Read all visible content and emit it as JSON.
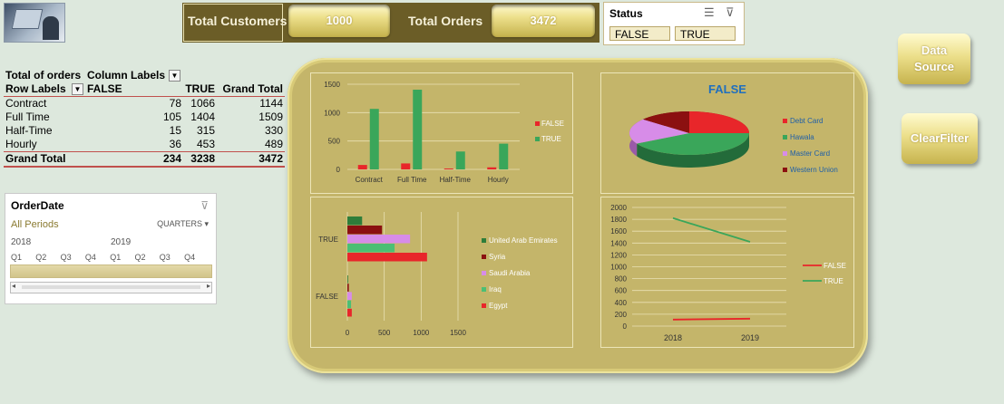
{
  "header": {
    "total_customers_label": "Total Customers",
    "total_customers_value": "1000",
    "total_orders_label": "Total Orders",
    "total_orders_value": "3472"
  },
  "status_slicer": {
    "title": "Status",
    "options": [
      "FALSE",
      "TRUE"
    ]
  },
  "buttons": {
    "data_source_line1": "Data",
    "data_source_line2": "Source",
    "clear_filter": "ClearFilter"
  },
  "pivot": {
    "header1": [
      "Total of orders",
      "Column Labels"
    ],
    "header2": [
      "Row Labels",
      "FALSE",
      "TRUE",
      "Grand Total"
    ],
    "rows": [
      {
        "label": "Contract",
        "false": "78",
        "true": "1066",
        "total": "1144"
      },
      {
        "label": "Full Time",
        "false": "105",
        "true": "1404",
        "total": "1509"
      },
      {
        "label": "Half-Time",
        "false": "15",
        "true": "315",
        "total": "330"
      },
      {
        "label": "Hourly",
        "false": "36",
        "true": "453",
        "total": "489"
      }
    ],
    "grand": {
      "label": "Grand Total",
      "false": "234",
      "true": "3238",
      "total": "3472"
    }
  },
  "timeline": {
    "title": "OrderDate",
    "period": "All Periods",
    "level": "QUARTERS",
    "years": [
      "2018",
      "2019"
    ],
    "quarters": [
      "Q1",
      "Q2",
      "Q3",
      "Q4",
      "Q1",
      "Q2",
      "Q3",
      "Q4"
    ]
  },
  "colors": {
    "false": "#e8262a",
    "true": "#3aa65a",
    "debit": "#e8262a",
    "hawala": "#3aa65a",
    "master": "#d78ce8",
    "western": "#8b1010",
    "uae": "#2e7d3a",
    "syria": "#8b1010",
    "saudi": "#d78ce8",
    "iraq": "#4bbf74",
    "egypt": "#e8262a"
  },
  "chart_data": [
    {
      "type": "bar",
      "categories": [
        "Contract",
        "Full Time",
        "Half-Time",
        "Hourly"
      ],
      "series": [
        {
          "name": "FALSE",
          "values": [
            78,
            105,
            15,
            36
          ]
        },
        {
          "name": "TRUE",
          "values": [
            1066,
            1404,
            315,
            453
          ]
        }
      ],
      "yticks": [
        "0",
        "500",
        "1000",
        "1500"
      ],
      "ylim": [
        0,
        1500
      ],
      "legend": "right"
    },
    {
      "type": "pie",
      "title": "FALSE",
      "labels": [
        "Debt Card",
        "Hawala",
        "Master Card",
        "Western Union"
      ],
      "values": [
        25,
        42,
        19,
        14
      ],
      "legend": "right"
    },
    {
      "type": "bar",
      "orientation": "horizontal",
      "categories": [
        "FALSE",
        "TRUE"
      ],
      "series": [
        {
          "name": "United Arab Emirates",
          "values": [
            10,
            200
          ]
        },
        {
          "name": "Syria",
          "values": [
            20,
            470
          ]
        },
        {
          "name": "Saudi Arabia",
          "values": [
            60,
            850
          ]
        },
        {
          "name": "Iraq",
          "values": [
            50,
            640
          ]
        },
        {
          "name": "Egypt",
          "values": [
            60,
            1080
          ]
        }
      ],
      "xticks": [
        "0",
        "500",
        "1000",
        "1500"
      ],
      "xlim": [
        0,
        1500
      ],
      "legend": "right"
    },
    {
      "type": "line",
      "x": [
        "2018",
        "2019"
      ],
      "series": [
        {
          "name": "FALSE",
          "values": [
            110,
            125
          ]
        },
        {
          "name": "TRUE",
          "values": [
            1820,
            1420
          ]
        }
      ],
      "yticks": [
        "0",
        "200",
        "400",
        "600",
        "800",
        "1000",
        "1200",
        "1400",
        "1600",
        "1800",
        "2000"
      ],
      "ylim": [
        0,
        2000
      ],
      "legend": "right"
    }
  ]
}
